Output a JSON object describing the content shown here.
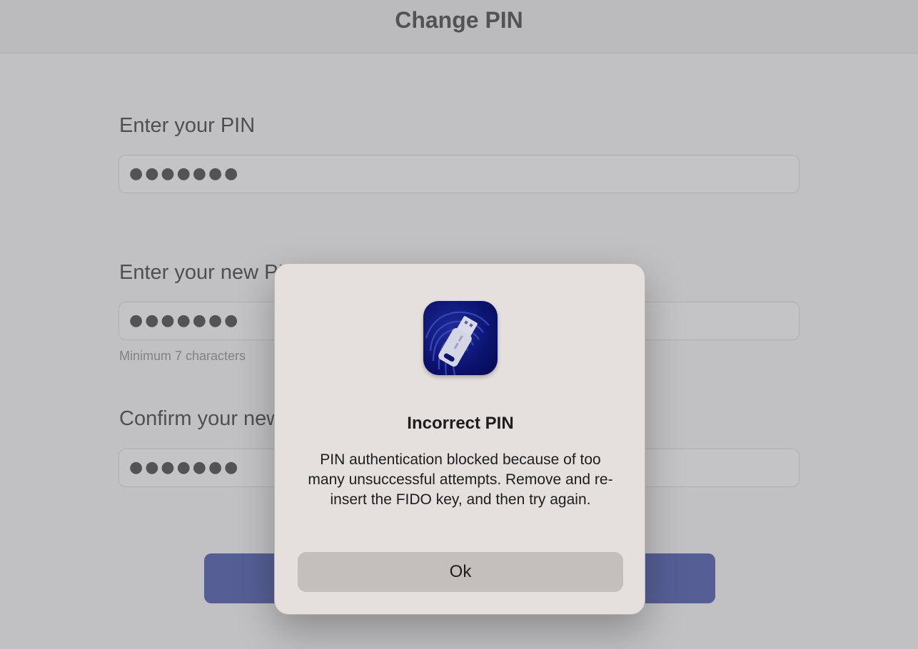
{
  "window": {
    "title": "Change PIN"
  },
  "form": {
    "current_pin": {
      "label": "Enter your PIN",
      "value": "●●●●●●●"
    },
    "new_pin": {
      "label": "Enter your new PIN",
      "value": "●●●●●●●",
      "hint": "Minimum 7 characters"
    },
    "confirm_pin": {
      "label": "Confirm your new PIN",
      "value": "●●●●●●●"
    },
    "submit": {
      "label": ""
    }
  },
  "dialog": {
    "icon": "usb-key-fingerprint-icon",
    "title": "Incorrect PIN",
    "message": "PIN authentication blocked because of too many unsuccessful attempts. Remove and re-insert the FIDO key, and then try again.",
    "ok_label": "Ok"
  },
  "colors": {
    "accent": "#3f4fa8",
    "dialog_bg": "#e5e0de",
    "dialog_button": "#c4bfbd"
  }
}
